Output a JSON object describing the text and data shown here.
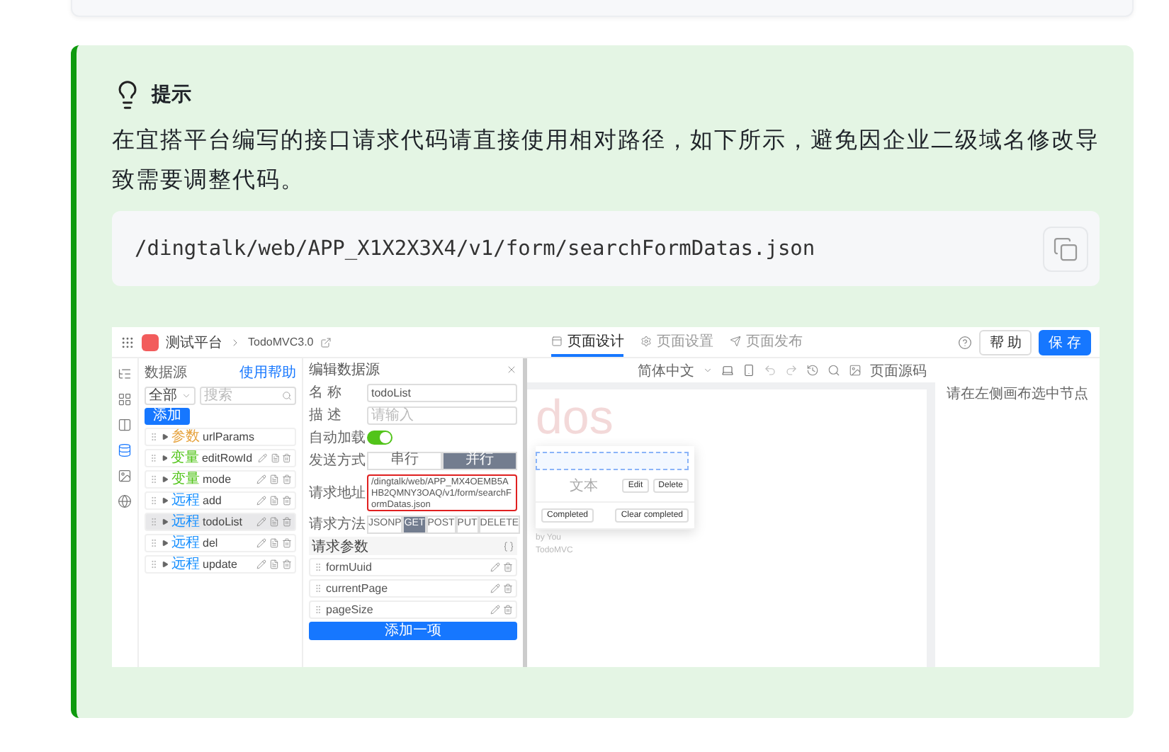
{
  "tip": {
    "title": "提示",
    "text": "在宜搭平台编写的接口请求代码请直接使用相对路径，如下所示，避免因企业二级域名修改导致需要调整代码。",
    "code": "/dingtalk/web/APP_X1X2X3X4/v1/form/searchFormDatas.json"
  },
  "screenshot": {
    "topbar": {
      "app_name": "测试平台",
      "page_name": "TodoMVC3.0",
      "tabs": [
        {
          "label": "页面设计",
          "selected": true
        },
        {
          "label": "页面设置",
          "selected": false
        },
        {
          "label": "页面发布",
          "selected": false
        }
      ],
      "buttons": [
        {
          "label": "帮 助",
          "kind": "default"
        },
        {
          "label": "保 存",
          "kind": "primary"
        }
      ]
    },
    "rail": [
      {
        "selected": false
      },
      {
        "selected": false
      },
      {
        "selected": false
      },
      {
        "selected": true
      },
      {
        "selected": false
      },
      {
        "selected": false
      }
    ],
    "datasource_panel": {
      "title": "数据源",
      "help_link": "使用帮助",
      "filter": "全部",
      "search_placeholder": "搜索",
      "add_button": "添加",
      "items": [
        {
          "tag": "参数",
          "color": "#e6a23c",
          "name": "urlParams",
          "selected": false
        },
        {
          "tag": "变量",
          "color": "#52c41a",
          "name": "editRowId",
          "selected": false
        },
        {
          "tag": "变量",
          "color": "#52c41a",
          "name": "mode",
          "selected": false
        },
        {
          "tag": "远程",
          "color": "#1890ff",
          "name": "add",
          "selected": false
        },
        {
          "tag": "远程",
          "color": "#1890ff",
          "name": "todoList",
          "selected": true
        },
        {
          "tag": "远程",
          "color": "#1890ff",
          "name": "del",
          "selected": false
        },
        {
          "tag": "远程",
          "color": "#1890ff",
          "name": "update",
          "selected": false
        }
      ]
    },
    "editor": {
      "title": "编辑数据源",
      "name_label": "名 称",
      "name_value": "todoList",
      "desc_label": "描 述",
      "desc_placeholder": "请输入",
      "autoload_label": "自动加载",
      "autoload_on": true,
      "send_mode_label": "发送方式",
      "send_modes": [
        {
          "label": "串行",
          "selected": false
        },
        {
          "label": "并行",
          "selected": true
        }
      ],
      "url_label": "请求地址",
      "url_value": "/dingtalk/web/APP_MX4OEMB5AHB2QMNY3OAQ/v1/form/searchFormDatas.json",
      "method_label": "请求方法",
      "methods": [
        {
          "label": "JSONP",
          "selected": false
        },
        {
          "label": "GET",
          "selected": true
        },
        {
          "label": "POST",
          "selected": false
        },
        {
          "label": "PUT",
          "selected": false
        },
        {
          "label": "DELETE",
          "selected": false
        }
      ],
      "params_label": "请求参数",
      "params": [
        "formUuid",
        "currentPage",
        "pageSize"
      ],
      "add_param": "添加一项"
    },
    "canvas": {
      "language": "简体中文",
      "source_button": "页面源码",
      "heading": "dos",
      "item_text": "文本",
      "item_buttons": [
        "Edit",
        "Delete"
      ],
      "filter_button": "Completed",
      "clear_button": "Clear completed",
      "footer": [
        "by You",
        "TodoMVC"
      ]
    },
    "inspector": {
      "hint": "请在左侧画布选中节点"
    }
  }
}
